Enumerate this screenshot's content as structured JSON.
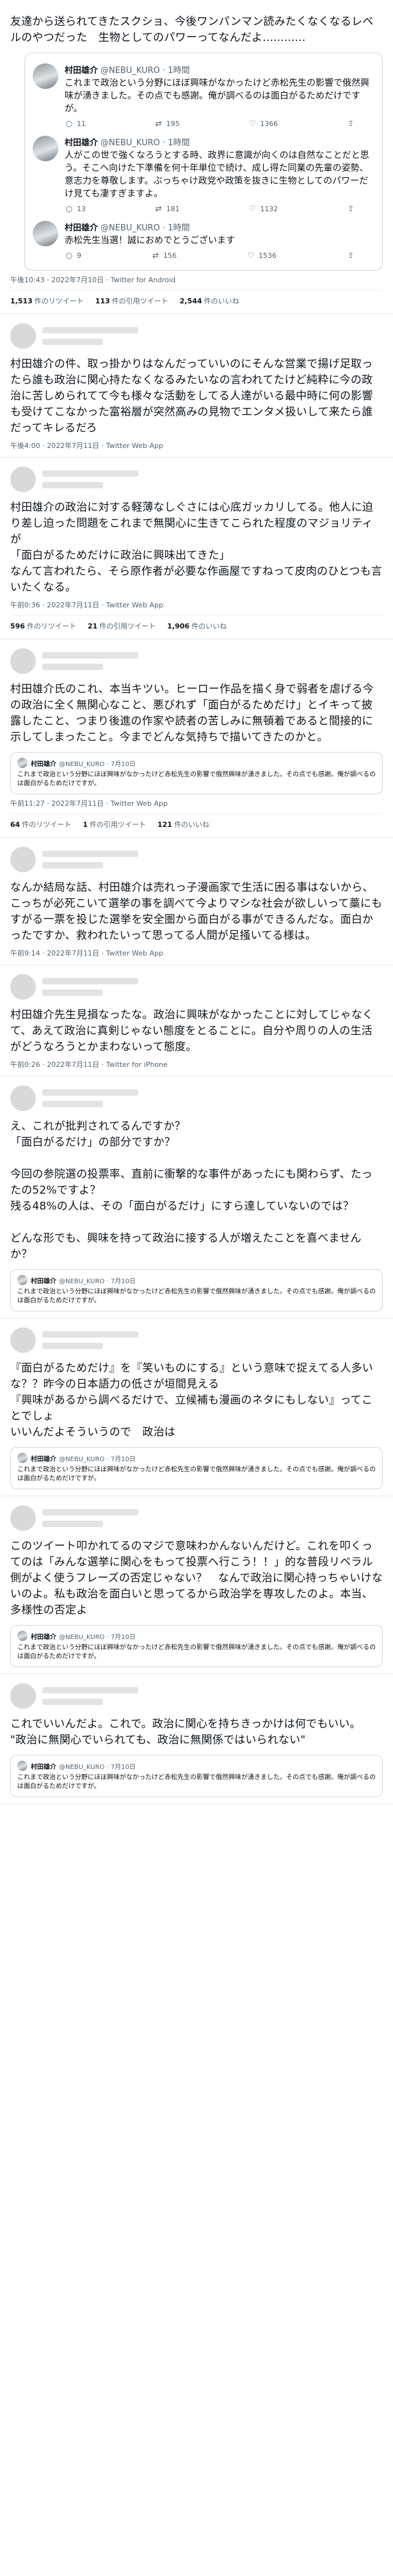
{
  "first": {
    "text": "友達から送られてきたスクショ、今後ワンパンマン読みたくなくなるレベルのやつだった　生物としてのパワーってなんだよ............",
    "quotes": [
      {
        "name": "村田雄介",
        "handle": "@NEBU_KURO · 1時間",
        "text": "これまで政治という分野にほぼ興味がなかったけど赤松先生の影響で俄然興味が湧きました。その点でも感謝。俺が調べるのは面白がるためだけですが。",
        "reply": "11",
        "retweet": "195",
        "like": "1366"
      },
      {
        "name": "村田雄介",
        "handle": "@NEBU_KURO · 1時間",
        "text": "人がこの世で強くなろうとする時、政界に意識が向くのは自然なことだと思う。そこへ向けた下準備を何十年単位で続け、成し得た同業の先輩の姿勢、意志力を尊敬します。ぶっちゃけ政党や政策を抜きに生物としてのパワーだけ見ても凄すぎますよ。",
        "reply": "13",
        "retweet": "181",
        "like": "1132"
      },
      {
        "name": "村田雄介",
        "handle": "@NEBU_KURO · 1時間",
        "text": "赤松先生当選！誠におめでとうございます",
        "reply": "9",
        "retweet": "156",
        "like": "1536"
      }
    ],
    "meta": "午後10:43 · 2022年7月10日 · Twitter for Android",
    "counts": [
      {
        "num": "1,513",
        "label": "件のリツイート"
      },
      {
        "num": "113",
        "label": "件の引用ツイート"
      },
      {
        "num": "2,544",
        "label": "件のいいね"
      }
    ]
  },
  "tweets": [
    {
      "text": "村田雄介の件、取っ掛かりはなんだっていいのにそんな営業で揚げ足取ったら誰も政治に関心持たなくなるみたいなの言われてたけど純粋に今の政治に苦しめられてて今も様々な活動をしてる人達がいる最中時に何の影響も受けてこなかった富裕層が突然高みの見物でエンタメ扱いして来たら誰だってキレるだろ",
      "meta": "午後4:00 · 2022年7月11日 · Twitter Web App",
      "counts": [],
      "quote": null
    },
    {
      "text": "村田雄介の政治に対する軽薄なしぐさには心底ガッカリしてる。他人に迫り差し迫った問題をこれまで無関心に生きてこられた程度のマジョリティが\n「面白がるためだけに政治に興味出てきた」\nなんて言われたら、そら原作者が必要な作画屋ですねって皮肉のひとつも言いたくなる。",
      "meta": "午前0:36 · 2022年7月11日 · Twitter Web App",
      "counts": [
        {
          "num": "596",
          "label": "件のリツイート"
        },
        {
          "num": "21",
          "label": "件の引用ツイート"
        },
        {
          "num": "1,906",
          "label": "件のいいね"
        }
      ],
      "quote": null
    },
    {
      "text": "村田雄介氏のこれ、本当キツい。ヒーロー作品を描く身で弱者を虐げる今の政治に全く無関心なこと、悪びれず「面白がるためだけ」とイキって披露したこと、つまり後進の作家や読者の苦しみに無頓着であると間接的に示してしまったこと。今までどんな気持ちで描いてきたのかと。",
      "meta": "午前11:27 · 2022年7月11日 · Twitter Web App",
      "counts": [
        {
          "num": "64",
          "label": "件のリツイート"
        },
        {
          "num": "1",
          "label": "件の引用ツイート"
        },
        {
          "num": "121",
          "label": "件のいいね"
        }
      ],
      "quote": {
        "name": "村田雄介",
        "handle": "@NEBU_KURO · 7月10日",
        "text": "これまで政治という分野にほぼ興味がなかったけど赤松先生の影響で俄然興味が湧きました。その点でも感謝。俺が調べるのは面白がるためだけですが。"
      }
    },
    {
      "text": "なんか結局な話、村田雄介は売れっ子漫画家で生活に困る事はないから、こっちが必死こいて選挙の事を調べて今よりマシな社会が欲しいって藁にもすがる一票を投じた選挙を安全圏から面白がる事ができるんだな。面白かったですか、救われたいって思ってる人間が足掻いてる様は。",
      "meta": "午前9:14 · 2022年7月11日 · Twitter Web App",
      "counts": [],
      "quote": null
    },
    {
      "text": "村田雄介先生見損なったな。政治に興味がなかったことに対してじゃなくて、あえて政治に真剣じゃない態度をとることに。自分や周りの人の生活がどうなろうとかまわないって態度。",
      "meta": "午前0:26 · 2022年7月11日 · Twitter for iPhone",
      "counts": [],
      "quote": null
    },
    {
      "text": "え、これが批判されてるんですか？\n「面白がるだけ」の部分ですか？\n\n今回の参院選の投票率、直前に衝撃的な事件があったにも関わらず、たったの52%ですよ？\n残る48%の人は、その「面白がるだけ」にすら達していないのでは？\n\nどんな形でも、興味を持って政治に接する人が増えたことを喜べませんか？",
      "meta": "",
      "counts": [],
      "quote": {
        "name": "村田雄介",
        "handle": "@NEBU_KURO · 7月10日",
        "text": "これまで政治という分野にほぼ興味がなかったけど赤松先生の影響で俄然興味が湧きました。その点でも感謝。俺が調べるのは面白がるためだけですが。"
      }
    },
    {
      "text": "『面白がるためだけ』を『笑いものにする』という意味で捉えてる人多いな？？昨今の日本語力の低さが垣間見える\n『興味があるから調べるだけで、立候補も漫画のネタにもしない』ってことでしょ\nいいんだよそういうので　政治は",
      "meta": "",
      "counts": [],
      "quote": {
        "name": "村田雄介",
        "handle": "@NEBU_KURO · 7月10日",
        "text": "これまで政治という分野にほぼ興味がなかったけど赤松先生の影響で俄然興味が湧きました。その点でも感謝。俺が調べるのは面白がるためだけですが。"
      }
    },
    {
      "text": "このツイート叩かれてるのマジで意味わかんないんだけど。これを叩くってのは「みんな選挙に関心をもって投票へ行こう！！」的な普段リベラル側がよく使うフレーズの否定じゃない？　なんで政治に関心持っちゃいけないのよ。私も政治を面白いと思ってるから政治学を専攻したのよ。本当、多様性の否定よ",
      "meta": "",
      "counts": [],
      "quote": {
        "name": "村田雄介",
        "handle": "@NEBU_KURO · 7月10日",
        "text": "これまで政治という分野にほぼ興味がなかったけど赤松先生の影響で俄然興味が湧きました。その点でも感謝。俺が調べるのは面白がるためだけですが。"
      }
    },
    {
      "text": "これでいいんだよ。これで。政治に関心を持ちきっかけは何でもいい。\n\"政治に無関心でいられても、政治に無関係ではいられない\"",
      "meta": "",
      "counts": [],
      "quote": {
        "name": "村田雄介",
        "handle": "@NEBU_KURO · 7月10日",
        "text": "これまで政治という分野にほぼ興味がなかったけど赤松先生の影響で俄然興味が湧きました。その点でも感謝。俺が調べるのは面白がるためだけですが。"
      }
    }
  ],
  "icons": {
    "reply": "reply-icon",
    "retweet": "retweet-icon",
    "like": "heart-icon",
    "share": "share-icon"
  }
}
